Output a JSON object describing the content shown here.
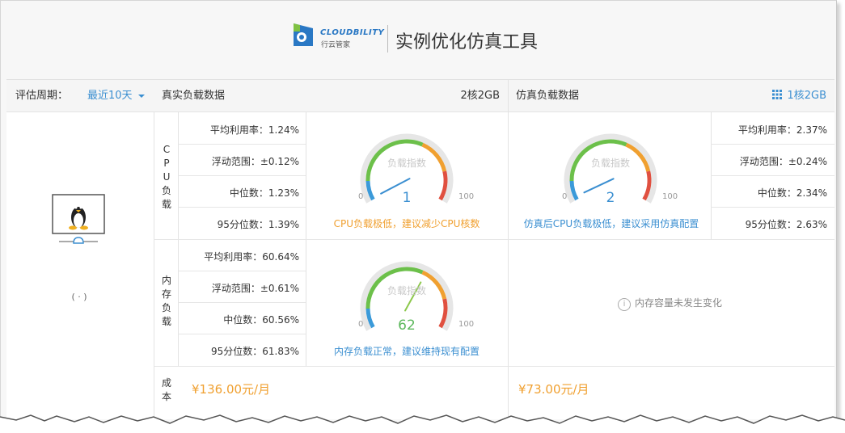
{
  "brand": {
    "name": "CLOUDBILITY",
    "subname": "行云管家"
  },
  "page_title": "实例优化仿真工具",
  "filter": {
    "label": "评估周期：",
    "value": "最近10天"
  },
  "real": {
    "title": "真实负载数据",
    "spec": "2核2GB",
    "cpu": {
      "section_label": [
        "C",
        "P",
        "U",
        "负",
        "载"
      ],
      "stats": [
        "平均利用率：1.24%",
        "浮动范围：±0.12%",
        "中位数：1.23%",
        "95分位数：1.39%"
      ],
      "gauge": {
        "title": "负载指数",
        "value": "1",
        "min": "0",
        "max": "100",
        "level": 1
      },
      "message": "CPU负载极低，建议减少CPU核数"
    },
    "memory": {
      "section_label": [
        "内",
        "存",
        "负",
        "载"
      ],
      "stats": [
        "平均利用率：60.64%",
        "浮动范围：±0.61%",
        "中位数：60.56%",
        "95分位数：61.83%"
      ],
      "gauge": {
        "title": "负载指数",
        "value": "62",
        "min": "0",
        "max": "100",
        "level": 62
      },
      "message": "内存负载正常，建议维持现有配置"
    },
    "cost": {
      "section_label": [
        "成",
        "本"
      ],
      "value": "¥136.00元/月"
    }
  },
  "sim": {
    "title": "仿真负载数据",
    "spec": "1核2GB",
    "cpu": {
      "stats": [
        "平均利用率：2.37%",
        "浮动范围：±0.24%",
        "中位数：2.34%",
        "95分位数：2.63%"
      ],
      "gauge": {
        "title": "负载指数",
        "value": "2",
        "min": "0",
        "max": "100",
        "level": 2
      },
      "message": "仿真后CPU负载极低，建议采用仿真配置"
    },
    "memory": {
      "info": "内存容量未发生变化"
    },
    "cost": {
      "value": "¥73.00元/月"
    }
  },
  "instance": {
    "caption": "(      ·      )"
  },
  "colors": {
    "accent": "#3b8fd1",
    "orange": "#f0a030",
    "green": "#5cb85c"
  }
}
